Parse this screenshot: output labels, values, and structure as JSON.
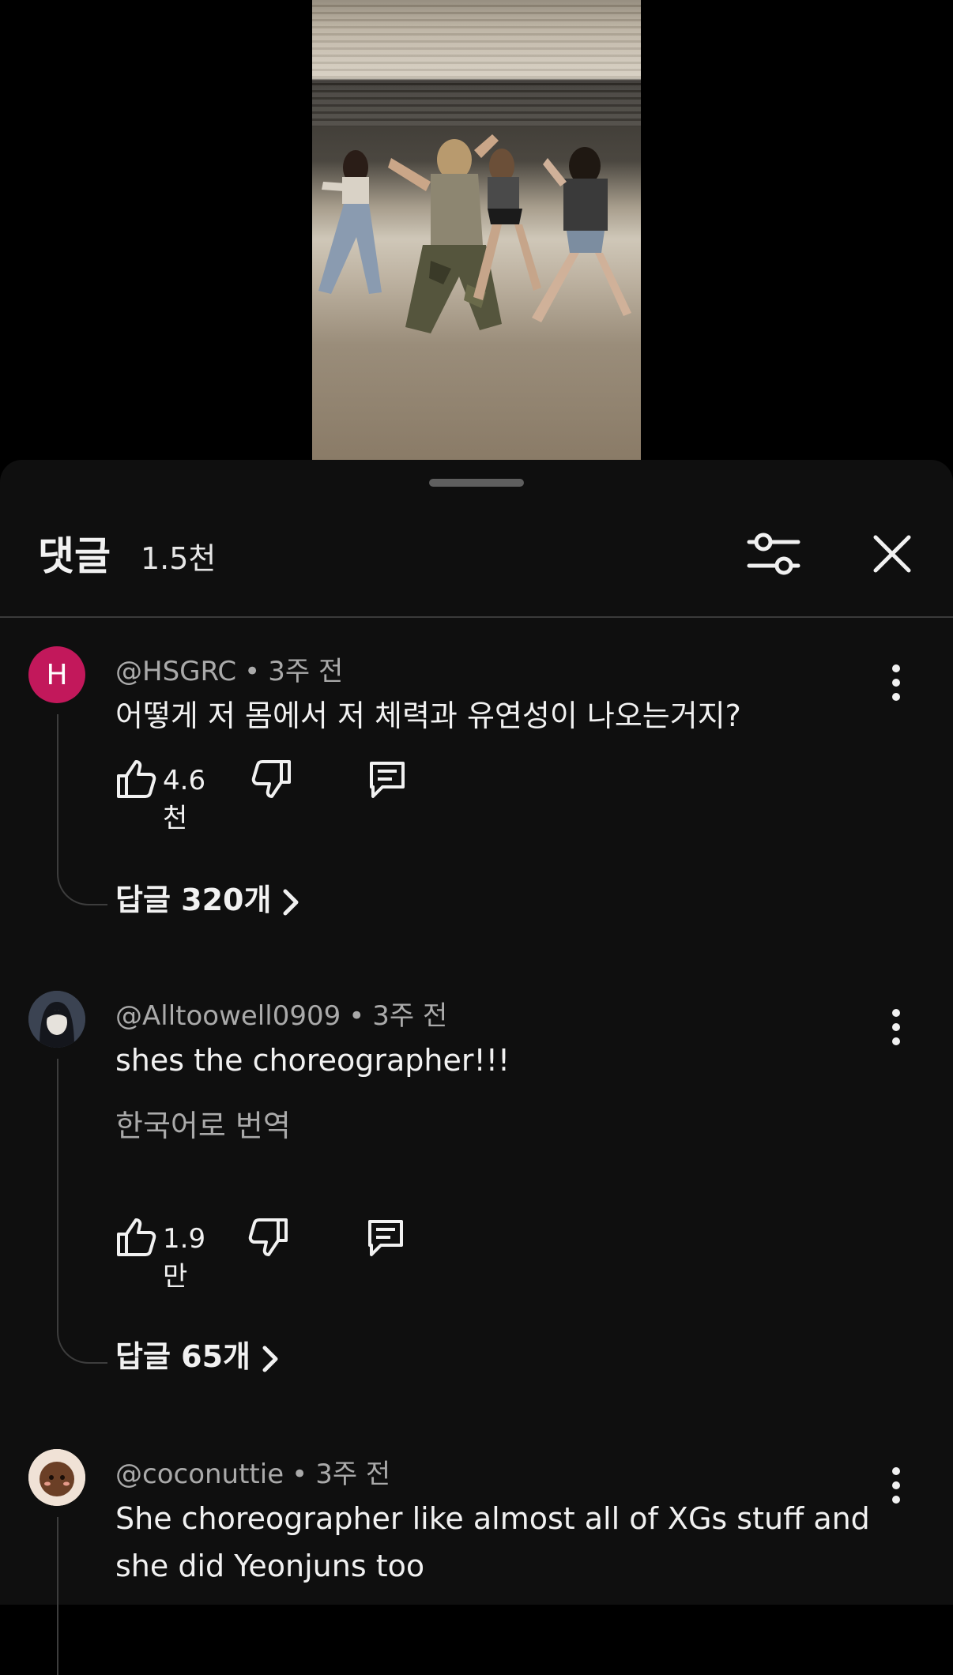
{
  "video": {},
  "sheet": {
    "title": "댓글",
    "count": "1.5천"
  },
  "comments": [
    {
      "avatar_letter": "H",
      "avatar_color": "#c2185b",
      "author": "@HSGRC",
      "time": "3주 전",
      "text": "어떻게 저 몸에서 저 체력과 유연성이 나오는거지?",
      "likes": "4.6천",
      "replies": "답글 320개"
    },
    {
      "author": "@Alltoowell0909",
      "time": "3주 전",
      "text": "shes the choreographer!!!",
      "translate": "한국어로 번역",
      "likes": "1.9만",
      "replies": "답글 65개"
    },
    {
      "author": "@coconuttie",
      "time": "3주 전",
      "text": "She choreographer like almost all of XGs stuff and she did Yeonjuns too"
    }
  ],
  "icons": [
    "filter-icon",
    "close-icon",
    "more-vert-icon",
    "thumb-up-icon",
    "thumb-down-icon",
    "reply-icon",
    "chevron-right-icon"
  ]
}
